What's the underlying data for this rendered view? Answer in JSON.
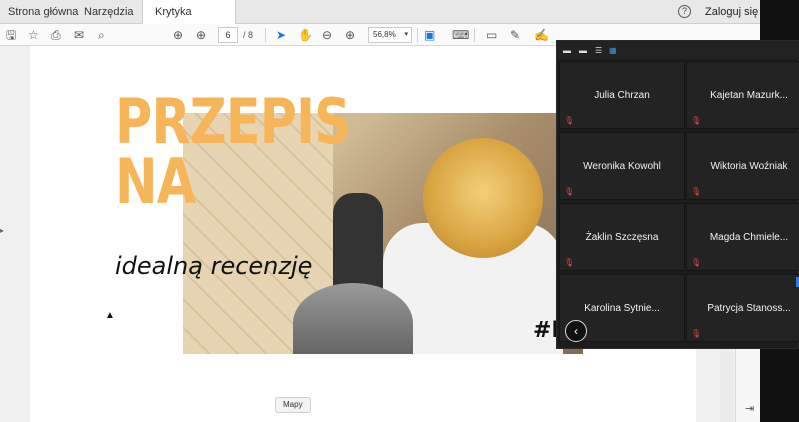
{
  "tabs": [
    {
      "label": "Strona główna"
    },
    {
      "label": "Narzędzia"
    },
    {
      "label": "Krytyka filmowa.pdf",
      "close": "×"
    }
  ],
  "header": {
    "help": "?",
    "login": "Zaloguj się"
  },
  "toolbar": {
    "page_current": "6",
    "page_total": "/ 8",
    "zoom": "56,8%",
    "zoom_caret": "▾",
    "icons": [
      "save-icon",
      "star-icon",
      "print-icon",
      "mail-icon",
      "search-icon",
      "arrow-up-icon",
      "arrow-down-icon",
      "select-cursor-icon",
      "hand-icon",
      "zoom-out-icon",
      "zoom-in-icon",
      "fit-page-icon",
      "keyboard-icon",
      "comment-icon",
      "pen-icon",
      "sign-icon",
      "tag-icon"
    ]
  },
  "document": {
    "title": "PRZEPIS\nNA",
    "subtitle": "idealną recenzję",
    "hashtag": "#B"
  },
  "bookmark_button": "Mapy",
  "meeting": {
    "participants": [
      "Julia Chrzan",
      "Kajetan Mazurk...",
      "Weronika Kowohl",
      "Wiktoria Woźniak",
      "Żaklin Szczęsna",
      "Magda Chmiele...",
      "Karolina Sytnie...",
      "Patrycja Stanoss..."
    ],
    "back_label": "‹"
  },
  "colors": {
    "title_orange": "#f7b55a",
    "mic_muted": "#e04848",
    "tile_bg": "#232323"
  }
}
